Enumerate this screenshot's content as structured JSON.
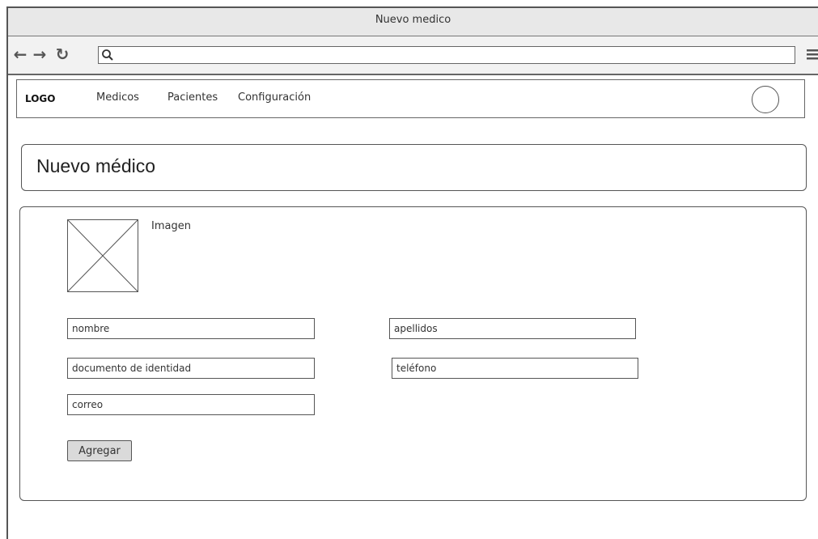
{
  "window": {
    "title": "Nuevo medico"
  },
  "browser": {
    "back_icon": "←",
    "forward_icon": "→",
    "reload_icon": "↻",
    "url_value": ""
  },
  "navbar": {
    "logo": "LOGO",
    "links": [
      "Medicos",
      "Pacientes",
      "Configuración"
    ]
  },
  "page": {
    "title": "Nuevo médico"
  },
  "form": {
    "image_label": "Imagen",
    "nombre_placeholder": "nombre",
    "apellidos_placeholder": "apellidos",
    "documento_placeholder": "documento de identidad",
    "telefono_placeholder": "teléfono",
    "correo_placeholder": "correo",
    "submit_label": "Agregar"
  }
}
